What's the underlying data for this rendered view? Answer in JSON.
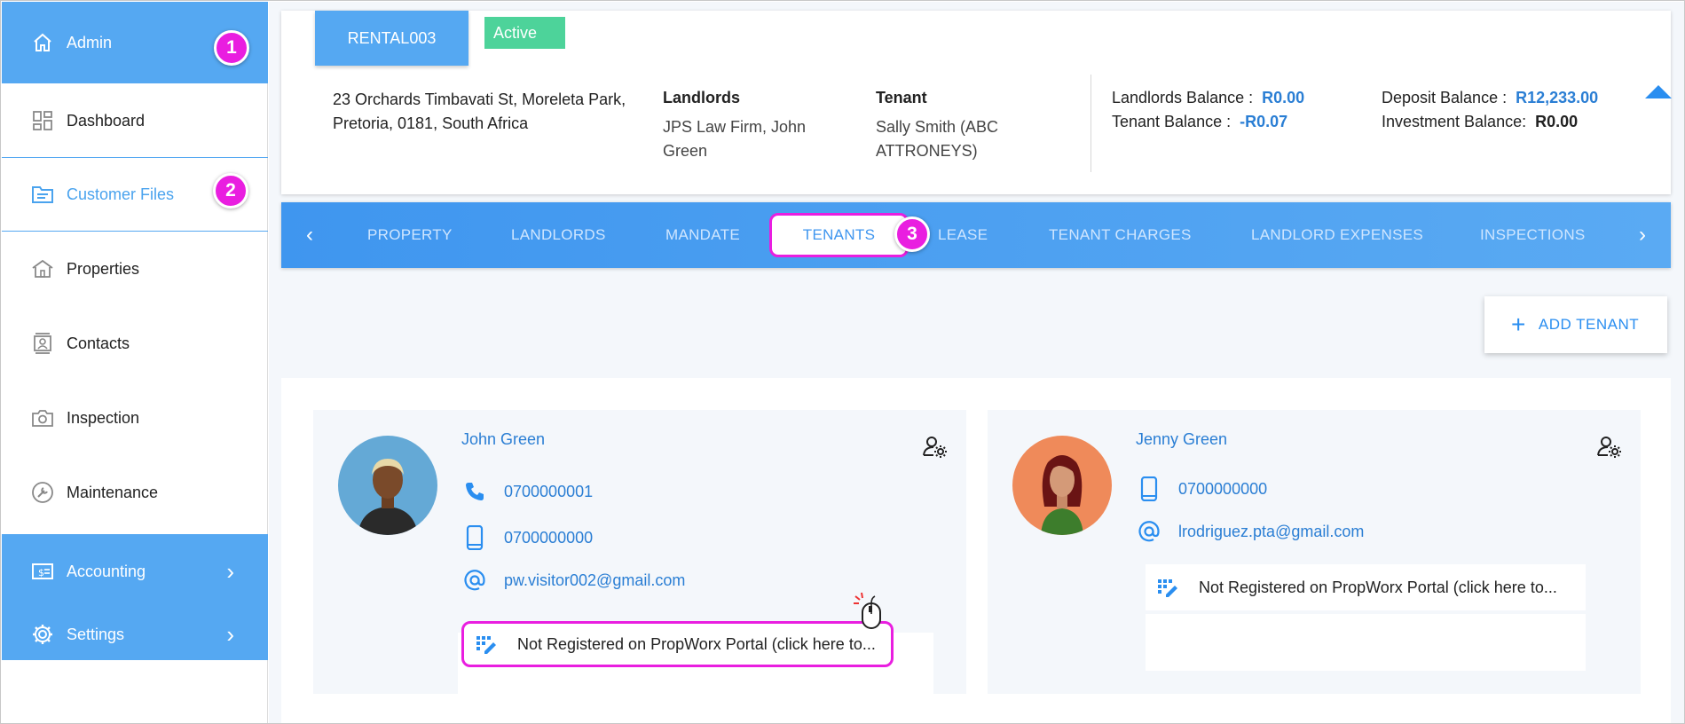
{
  "sidebar": {
    "items": [
      {
        "label": "Admin",
        "icon": "home-icon"
      },
      {
        "label": "Dashboard",
        "icon": "dashboard-icon"
      },
      {
        "label": "Customer Files",
        "icon": "folder-icon"
      },
      {
        "label": "Properties",
        "icon": "house-icon"
      },
      {
        "label": "Contacts",
        "icon": "contacts-icon"
      },
      {
        "label": "Inspection",
        "icon": "camera-icon"
      },
      {
        "label": "Maintenance",
        "icon": "wrench-icon"
      },
      {
        "label": "Accounting",
        "icon": "money-icon"
      },
      {
        "label": "Settings",
        "icon": "gear-icon"
      }
    ],
    "chevron": "›"
  },
  "steps": [
    "1",
    "2",
    "3"
  ],
  "header": {
    "rental_code": "RENTAL003",
    "status": "Active",
    "address": "23 Orchards Timbavati St, Moreleta Park, Pretoria, 0181, South Africa",
    "landlords_heading": "Landlords",
    "landlords_value": "JPS Law Firm, John Green",
    "tenant_heading": "Tenant",
    "tenant_value": "Sally Smith (ABC ATTRONEYS)",
    "landlords_balance_label": "Landlords Balance :",
    "landlords_balance_value": "R0.00",
    "tenant_balance_label": "Tenant Balance :",
    "tenant_balance_value": "-R0.07",
    "deposit_balance_label": "Deposit Balance :",
    "deposit_balance_value": "R12,233.00",
    "investment_balance_label": "Investment Balance:",
    "investment_balance_value": "R0.00"
  },
  "tabs": {
    "prev": "‹",
    "next": "›",
    "items": [
      "PROPERTY",
      "LANDLORDS",
      "MANDATE",
      "TENANTS",
      "LEASE",
      "TENANT CHARGES",
      "LANDLORD EXPENSES",
      "INSPECTIONS"
    ],
    "selected": "TENANTS"
  },
  "add_tenant": {
    "plus": "+",
    "label": "ADD TENANT"
  },
  "tenants": [
    {
      "name": "John Green",
      "phone": "0700000001",
      "mobile": "0700000000",
      "email": "pw.visitor002@gmail.com",
      "portal": "Not Registered on PropWorx Portal (click here to..."
    },
    {
      "name": "Jenny Green",
      "mobile": "0700000000",
      "email": "lrodriguez.pta@gmail.com",
      "portal": "Not Registered on PropWorx Portal (click here to..."
    }
  ],
  "colors": {
    "sidebar_blue": "#55a8f2",
    "accent": "#2a7ed4",
    "highlight": "#e91ee0",
    "active_green": "#4dd39a"
  }
}
